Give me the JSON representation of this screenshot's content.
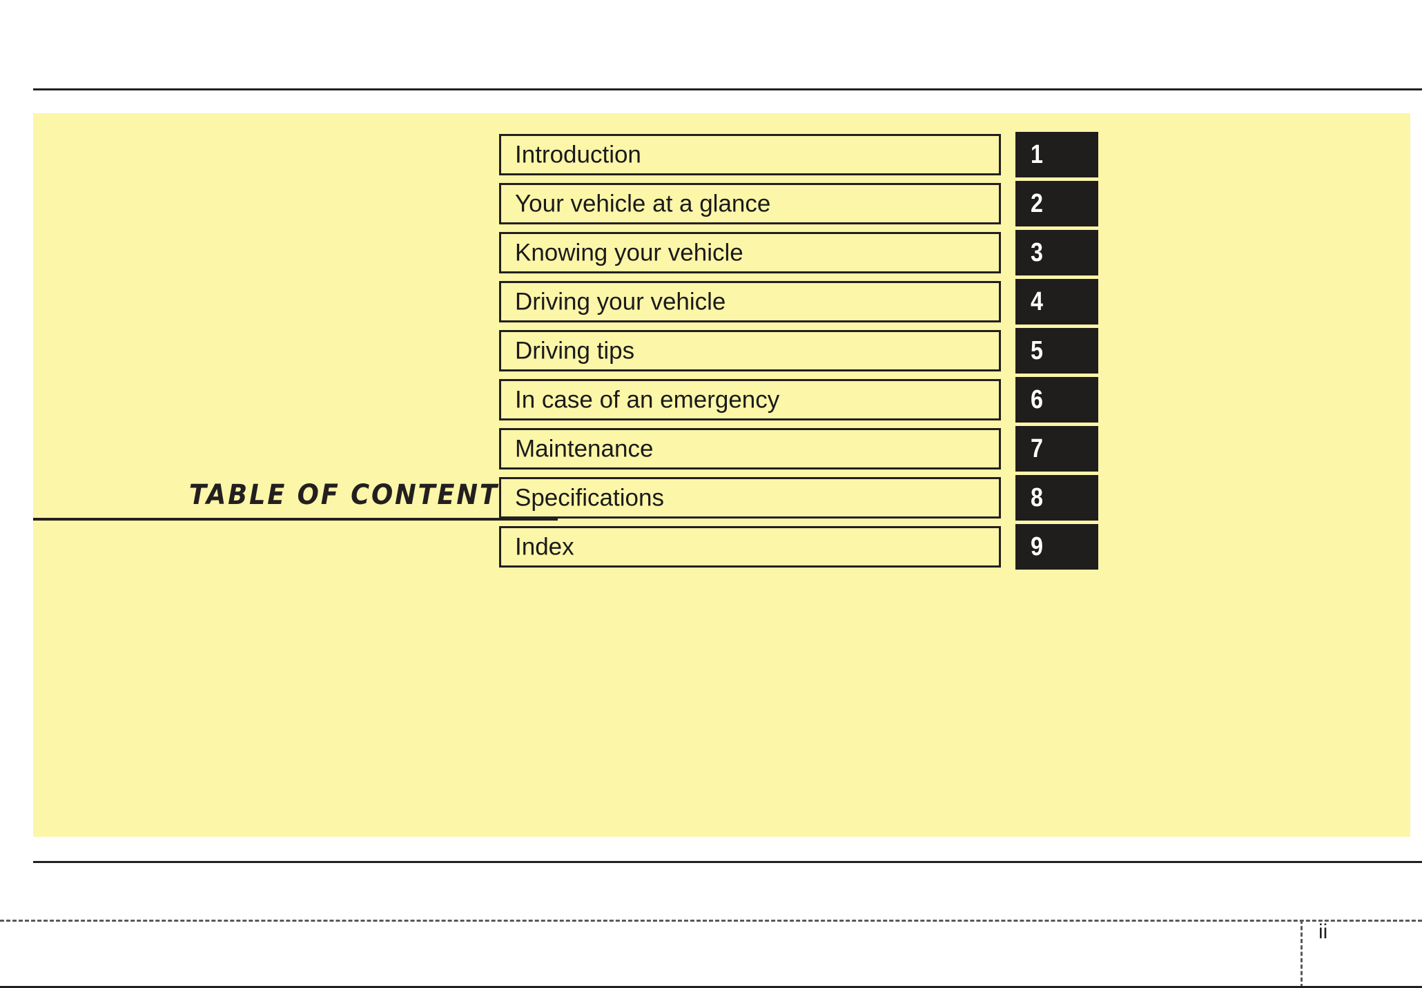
{
  "page": {
    "title": "TABLE OF CONTENTS",
    "folio": "ii",
    "panel_color": "#fcf6a8",
    "ink_color": "#231f20",
    "tab_color": "#201d1d",
    "tab_text_color": "#ffffff"
  },
  "contents": [
    {
      "label": "Introduction",
      "number": "1"
    },
    {
      "label": "Your vehicle at a glance",
      "number": "2"
    },
    {
      "label": "Knowing your vehicle",
      "number": "3"
    },
    {
      "label": "Driving your vehicle",
      "number": "4"
    },
    {
      "label": "Driving tips",
      "number": "5"
    },
    {
      "label": "In case of an emergency",
      "number": "6"
    },
    {
      "label": "Maintenance",
      "number": "7"
    },
    {
      "label": "Specifications",
      "number": "8"
    },
    {
      "label": "Index",
      "number": "9"
    }
  ]
}
